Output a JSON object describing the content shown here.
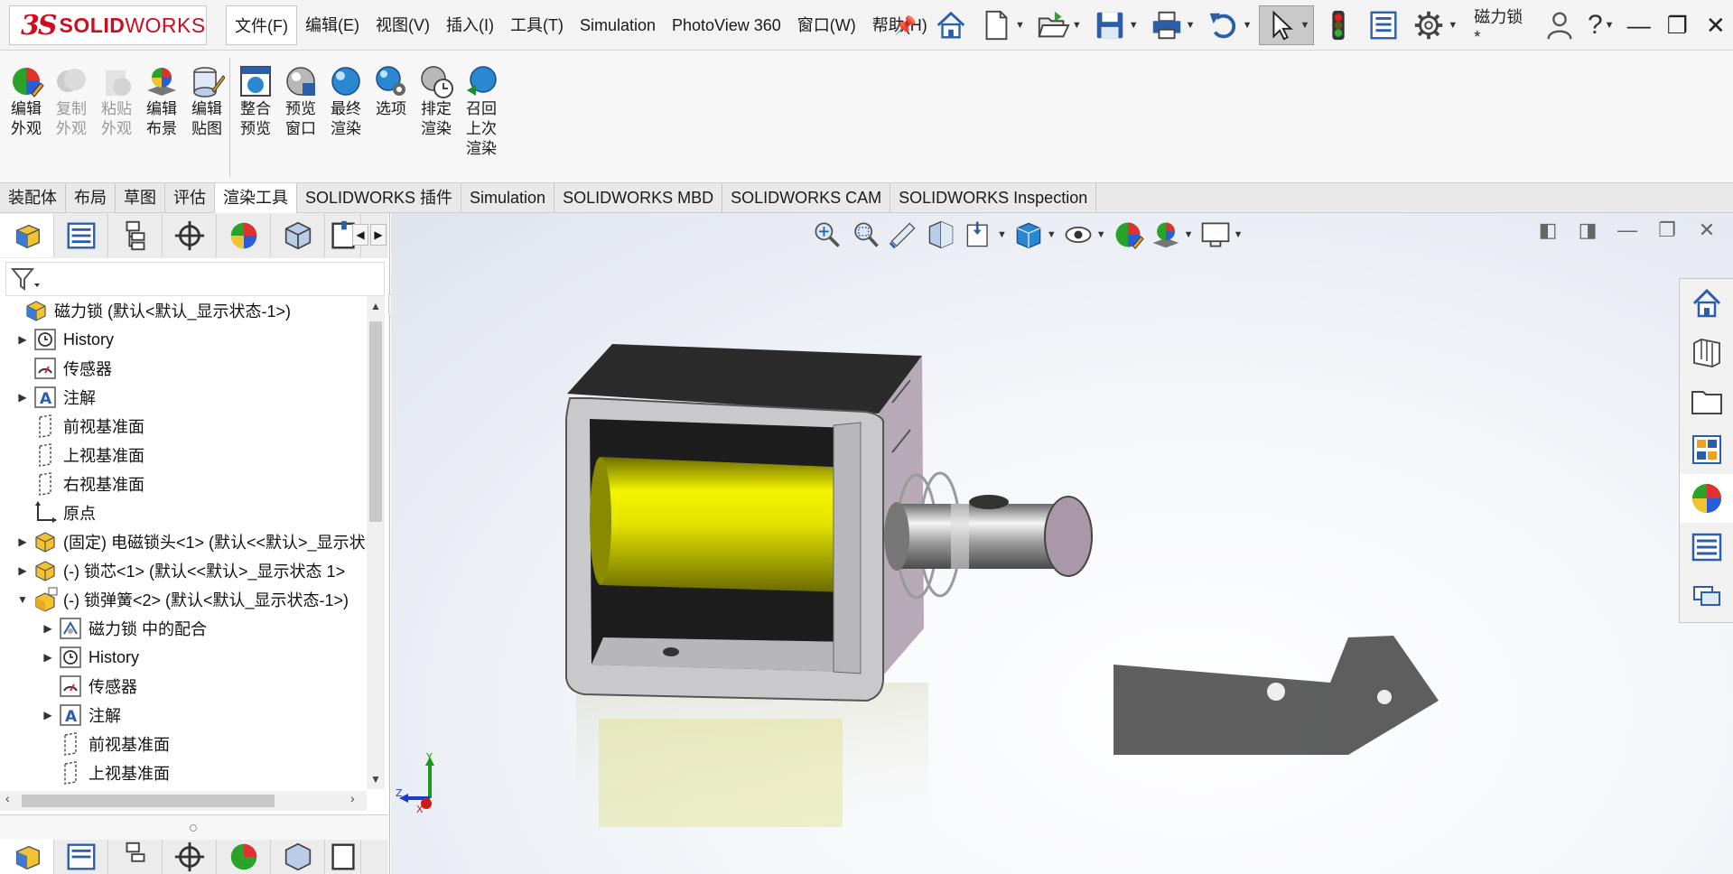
{
  "app": {
    "logo_ds": "3S",
    "logo_brand_bold": "SOLID",
    "logo_brand_rest": "WORKS"
  },
  "menu": [
    "文件(F)",
    "编辑(E)",
    "视图(V)",
    "插入(I)",
    "工具(T)",
    "Simulation",
    "PhotoView 360",
    "窗口(W)",
    "帮助(H)"
  ],
  "quick_access": {
    "icons": [
      "home-icon",
      "new-document-icon",
      "open-icon",
      "save-icon",
      "print-icon",
      "undo-icon",
      "select-icon",
      "rebuild-traffic-light-icon",
      "file-properties-icon",
      "options-gear-icon"
    ],
    "document_name": "磁力锁 *"
  },
  "ribbon": {
    "appearance_group": [
      {
        "label": "编辑\n外观",
        "icon": "edit-appearance-icon",
        "enabled": true
      },
      {
        "label": "复制\n外观",
        "icon": "copy-appearance-icon",
        "enabled": false
      },
      {
        "label": "粘贴\n外观",
        "icon": "paste-appearance-icon",
        "enabled": false
      },
      {
        "label": "编辑\n布景",
        "icon": "edit-scene-icon",
        "enabled": true
      },
      {
        "label": "编辑\n贴图",
        "icon": "edit-decal-icon",
        "enabled": true
      }
    ],
    "render_group": [
      {
        "label": "整合\n预览",
        "icon": "integrated-preview-icon"
      },
      {
        "label": "预览\n窗口",
        "icon": "preview-window-icon"
      },
      {
        "label": "最终\n渲染",
        "icon": "final-render-icon"
      },
      {
        "label": "选项",
        "icon": "render-options-icon"
      },
      {
        "label": "排定\n渲染",
        "icon": "schedule-render-icon"
      },
      {
        "label": "召回\n上次\n渲染",
        "icon": "recall-last-render-icon"
      }
    ]
  },
  "tabs": [
    "装配体",
    "布局",
    "草图",
    "评估",
    "渲染工具",
    "SOLIDWORKS 插件",
    "Simulation",
    "SOLIDWORKS MBD",
    "SOLIDWORKS CAM",
    "SOLIDWORKS Inspection"
  ],
  "active_tab": "渲染工具",
  "feature_tree": [
    {
      "text": "磁力锁  (默认<默认_显示状态-1>)",
      "icon": "assembly-icon",
      "indent": 0,
      "arrow": ""
    },
    {
      "text": "History",
      "icon": "history-icon",
      "indent": 1,
      "arrow": "collapsed"
    },
    {
      "text": "传感器",
      "icon": "sensor-icon",
      "indent": 1,
      "arrow": ""
    },
    {
      "text": "注解",
      "icon": "annotation-icon",
      "indent": 1,
      "arrow": "collapsed"
    },
    {
      "text": "前视基准面",
      "icon": "plane-icon",
      "indent": 1,
      "arrow": ""
    },
    {
      "text": "上视基准面",
      "icon": "plane-icon",
      "indent": 1,
      "arrow": ""
    },
    {
      "text": "右视基准面",
      "icon": "plane-icon",
      "indent": 1,
      "arrow": ""
    },
    {
      "text": "原点",
      "icon": "origin-icon",
      "indent": 1,
      "arrow": ""
    },
    {
      "text": "(固定) 电磁锁头<1> (默认<<默认>_显示状",
      "icon": "part-icon",
      "indent": 1,
      "arrow": "collapsed"
    },
    {
      "text": "(-) 锁芯<1> (默认<<默认>_显示状态 1>",
      "icon": "part-icon",
      "indent": 1,
      "arrow": "collapsed"
    },
    {
      "text": "(-) 锁弹簧<2> (默认<默认_显示状态-1>)",
      "icon": "subassembly-icon",
      "indent": 1,
      "arrow": "expanded"
    },
    {
      "text": "磁力锁 中的配合",
      "icon": "mates-icon",
      "indent": 2,
      "arrow": "collapsed"
    },
    {
      "text": "History",
      "icon": "history-icon",
      "indent": 2,
      "arrow": "collapsed"
    },
    {
      "text": "传感器",
      "icon": "sensor-icon",
      "indent": 2,
      "arrow": ""
    },
    {
      "text": "注解",
      "icon": "annotation-icon",
      "indent": 2,
      "arrow": "collapsed"
    },
    {
      "text": "前视基准面",
      "icon": "plane-icon",
      "indent": 2,
      "arrow": ""
    },
    {
      "text": "上视基准面",
      "icon": "plane-icon",
      "indent": 2,
      "arrow": ""
    }
  ],
  "panel_tabs": [
    "feature-manager-icon",
    "property-manager-icon",
    "configuration-manager-icon",
    "dimxpert-icon",
    "display-manager-icon",
    "render-manager-icon",
    "cam-icon"
  ],
  "heads_up_toolbar": [
    "zoom-to-fit-icon",
    "zoom-to-area-icon",
    "previous-view-icon",
    "section-view-icon",
    "view-orientation-icon",
    "display-style-icon",
    "hide-show-items-icon",
    "edit-appearance-icon",
    "apply-scene-icon",
    "view-settings-icon"
  ],
  "task_pane": [
    "solidworks-resources-icon",
    "design-library-icon",
    "file-explorer-icon",
    "view-palette-icon",
    "appearances-scenes-icon",
    "custom-properties-icon",
    "forum-icon"
  ],
  "triad": {
    "y": "Y",
    "z": "Z",
    "x": "X"
  },
  "colors": {
    "brand_red": "#d10a1e",
    "coil_yellow": "#d6d600",
    "housing_dark": "#2b2b2b",
    "frame_gray": "#c9c9cc"
  }
}
